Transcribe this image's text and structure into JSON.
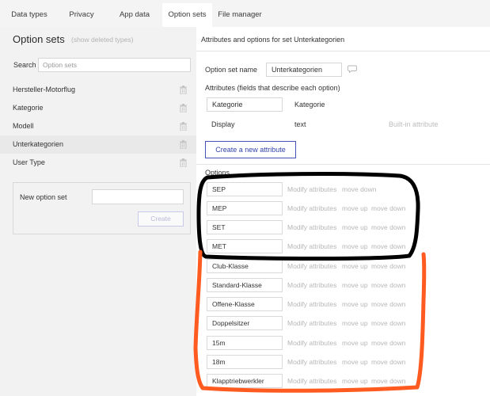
{
  "tabs": [
    {
      "label": "Data types",
      "active": false
    },
    {
      "label": "Privacy",
      "active": false
    },
    {
      "label": "App data",
      "active": false
    },
    {
      "label": "Option sets",
      "active": true
    },
    {
      "label": "File manager",
      "active": false
    }
  ],
  "left_panel": {
    "title": "Option sets",
    "show_deleted_link": "(show deleted types)",
    "search_label": "Search",
    "search_placeholder": "Option sets",
    "option_sets": [
      {
        "name": "Hersteller-Motorflug",
        "selected": false
      },
      {
        "name": "Kategorie",
        "selected": false
      },
      {
        "name": "Modell",
        "selected": false
      },
      {
        "name": "Unterkategorien",
        "selected": true
      },
      {
        "name": "User Type",
        "selected": false
      }
    ],
    "new_option_set_label": "New option set",
    "create_button": "Create"
  },
  "right_panel": {
    "title": "Attributes and options for set Unterkategorien",
    "option_set_name_label": "Option set name",
    "option_set_name_value": "Unterkategorien",
    "attributes_heading": "Attributes (fields that describe each option)",
    "attributes": [
      {
        "name": "Kategorie",
        "type": "Kategorie",
        "note": "",
        "editable": true
      },
      {
        "name": "Display",
        "type": "text",
        "note": "Built-in attribute",
        "editable": false
      }
    ],
    "create_attribute_button": "Create a new attribute",
    "options_heading": "Options",
    "actions": {
      "modify": "Modify attributes",
      "move_up": "move up",
      "move_down": "move down"
    },
    "options": [
      "SEP",
      "MEP",
      "SET",
      "MET",
      "Club-Klasse",
      "Standard-Klasse",
      "Offene-Klasse",
      "Doppelsitzer",
      "15m",
      "18m",
      "Klapptriebwerkler"
    ]
  },
  "colors": {
    "accent": "#3344a8",
    "annotation_black": "#000000",
    "annotation_orange": "#ff5a1f"
  }
}
